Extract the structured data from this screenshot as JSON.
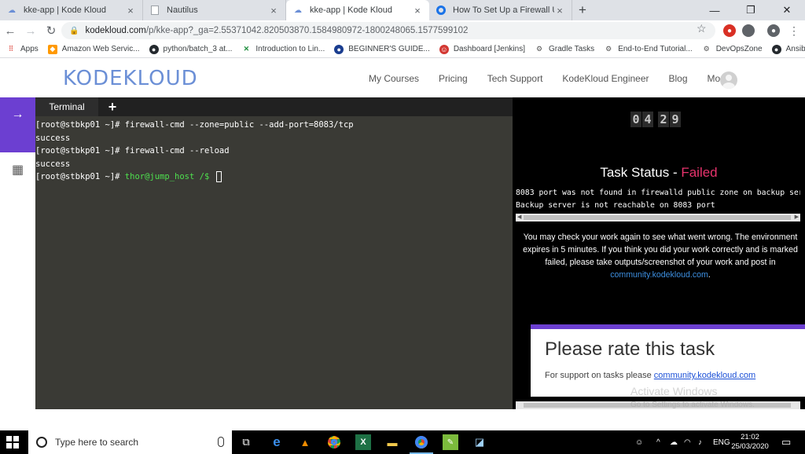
{
  "browser": {
    "tabs": [
      {
        "title": "kke-app | Kode Kloud",
        "icon": "kodekloud-favicon",
        "active": false
      },
      {
        "title": "Nautilus",
        "icon": "blank-page-favicon",
        "active": false
      },
      {
        "title": "kke-app | Kode Kloud",
        "icon": "kodekloud-favicon",
        "active": true
      },
      {
        "title": "How To Set Up a Firewall Using F",
        "icon": "digitalocean-favicon",
        "active": false
      }
    ],
    "url_host": "kodekloud.com",
    "url_path": "/p/kke-app?_ga=2.55371042.820503870.1584980972-1800248065.1577599102",
    "bookmarks": [
      {
        "label": "Apps",
        "icon": "apps-grid-icon"
      },
      {
        "label": "Amazon Web Servic...",
        "icon": "aws-icon"
      },
      {
        "label": "python/batch_3 at...",
        "icon": "github-icon"
      },
      {
        "label": "Introduction to Lin...",
        "icon": "dx-icon"
      },
      {
        "label": "BEGINNER'S GUIDE...",
        "icon": "globe-icon"
      },
      {
        "label": "Dashboard [Jenkins]",
        "icon": "jenkins-icon"
      },
      {
        "label": "Gradle Tasks",
        "icon": "gradle-icon"
      },
      {
        "label": "End-to-End Tutorial...",
        "icon": "gear-icon"
      },
      {
        "label": "DevOpsZone",
        "icon": "gear-icon"
      },
      {
        "label": "Ansible_role",
        "icon": "github-icon"
      }
    ]
  },
  "site": {
    "logo": "KODEKLOUD",
    "nav": [
      "My Courses",
      "Pricing",
      "Tech Support",
      "KodeKloud Engineer",
      "Blog",
      "More"
    ]
  },
  "terminal": {
    "tab_label": "Terminal",
    "add_label": "+",
    "lines": [
      {
        "prompt": "[root@stbkp01 ~]# ",
        "text": "firewall-cmd --zone=public --add-port=8083/tcp"
      },
      {
        "prompt": "",
        "text": "success"
      },
      {
        "prompt": "[root@stbkp01 ~]# ",
        "text": "firewall-cmd --reload"
      },
      {
        "prompt": "",
        "text": "success"
      },
      {
        "prompt": "[root@stbkp01 ~]# ",
        "text": "thor@jump_host /$ "
      }
    ]
  },
  "task": {
    "timer": [
      "0",
      "4",
      "2",
      "9"
    ],
    "status_label": "Task Status - ",
    "status_value": "Failed",
    "errors": [
      "8083 port was not found in firewalld public zone on backup ser",
      "Backup server is not reachable on 8083 port"
    ],
    "check_msg": "You may check your work again to see what went wrong. The environment expires in 5 minutes. If you think you did your work correctly and is marked failed, please take outputs/screenshot of your work and post in",
    "check_link": "community.kodekloud.com",
    "check_end": ".",
    "rate_title": "Please rate this task",
    "support_text": "For support on tasks please ",
    "support_link": "community.kodekloud.com",
    "colors": {
      "failed": "#e8336d",
      "accent": "#6c3fd1",
      "link": "#3d8fe0"
    }
  },
  "os": {
    "watermark_title": "Activate Windows",
    "watermark_sub": "Go to Settings to activate Windows.",
    "search_placeholder": "Type here to search",
    "lang": "ENG",
    "time": "21:02",
    "date": "25/03/2020"
  }
}
